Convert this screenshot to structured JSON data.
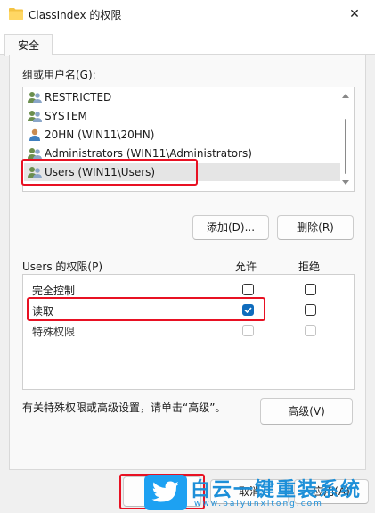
{
  "window": {
    "title": "ClassIndex 的权限",
    "close_glyph": "✕"
  },
  "tabs": [
    {
      "label": "安全"
    }
  ],
  "groups": {
    "label": "组或用户名(G):",
    "items": [
      {
        "label": "RESTRICTED",
        "icon": "group-users-icon"
      },
      {
        "label": "SYSTEM",
        "icon": "group-users-icon"
      },
      {
        "label": "20HN (WIN11\\20HN)",
        "icon": "single-user-icon"
      },
      {
        "label": "Administrators (WIN11\\Administrators)",
        "icon": "group-users-icon"
      },
      {
        "label": "Users (WIN11\\Users)",
        "icon": "group-users-icon",
        "selected": true
      }
    ]
  },
  "buttons": {
    "add": "添加(D)...",
    "remove": "删除(R)",
    "advanced": "高级(V)",
    "cancel": "取消",
    "apply": "应用(A)"
  },
  "permissions": {
    "label": "Users 的权限(P)",
    "allow_header": "允许",
    "deny_header": "拒绝",
    "rows": [
      {
        "name": "完全控制",
        "allow": false,
        "deny": false,
        "disabled": false
      },
      {
        "name": "读取",
        "allow": true,
        "deny": false,
        "disabled": false
      },
      {
        "name": "特殊权限",
        "allow": false,
        "deny": false,
        "disabled": true
      }
    ]
  },
  "advanced_hint": "有关特殊权限或高级设置，请单击“高级”。",
  "watermark": {
    "text": "白云一键重装系统",
    "url": "www.baiyunxitong.com"
  },
  "colors": {
    "highlight": "#e81123",
    "accent": "#0f6cbd",
    "watermark": "#1d8fd8"
  }
}
